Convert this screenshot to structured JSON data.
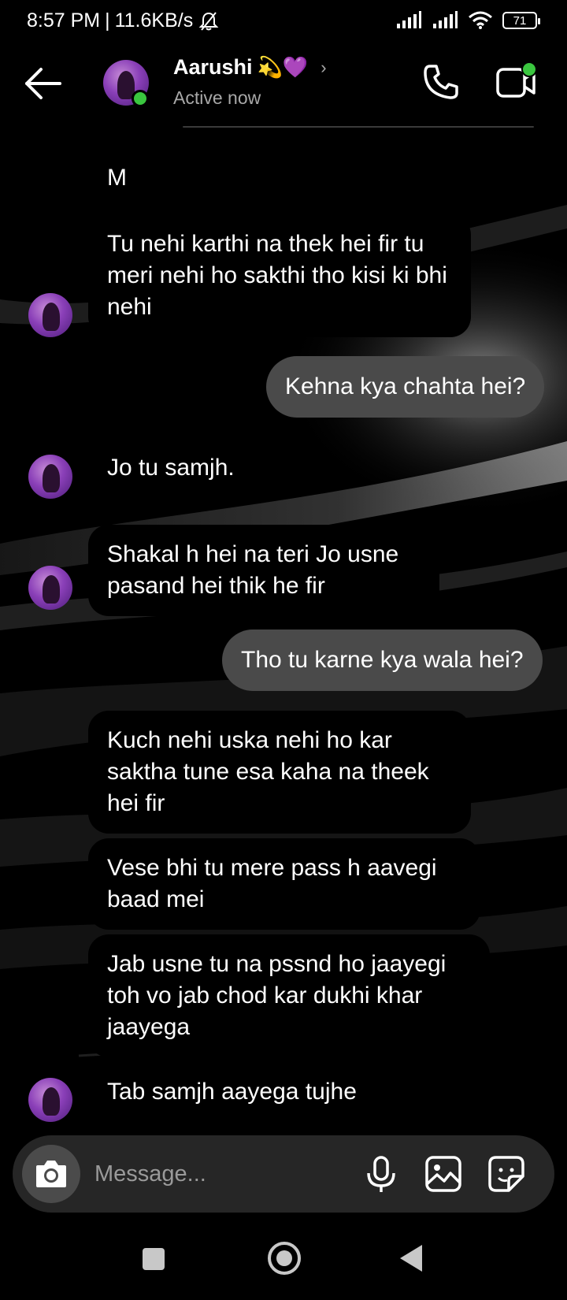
{
  "status_bar": {
    "time": "8:57 PM",
    "separator": "|",
    "speed": "11.6KB/s",
    "battery": "71",
    "icons": [
      "mute-bell-icon",
      "signal-icon",
      "signal-icon",
      "wifi-icon",
      "battery-icon"
    ]
  },
  "header": {
    "contact_name": "Aarushi",
    "name_emoji": "💫💜",
    "chevron": "›",
    "status": "Active now",
    "online_color": "#3ac63f"
  },
  "messages": [
    {
      "side": "received",
      "text": "M"
    },
    {
      "side": "received",
      "text": "Tu nehi karthi na thek hei fir tu meri nehi ho sakthi tho kisi ki bhi nehi"
    },
    {
      "side": "sent",
      "text": "Kehna kya chahta hei?"
    },
    {
      "side": "received",
      "text": "Jo tu samjh."
    },
    {
      "side": "received",
      "text": "Shakal h hei na teri Jo usne pasand hei thik he fir"
    },
    {
      "side": "sent",
      "text": "Tho tu karne kya wala hei?"
    },
    {
      "side": "received",
      "text": "Kuch nehi uska nehi ho kar saktha tune esa kaha na theek hei fir"
    },
    {
      "side": "received",
      "text": "Vese bhi tu mere pass h aavegi baad mei"
    },
    {
      "side": "received",
      "text": "Jab usne tu na pssnd ho jaayegi toh vo jab chod kar dukhi khar jaayega"
    },
    {
      "side": "received",
      "text": "Tab samjh aayega tujhe"
    }
  ],
  "composer": {
    "placeholder": "Message..."
  },
  "colors": {
    "sent_bubble": "#4a4a4a",
    "received_bubble": "#000000",
    "composer_bg": "#262626"
  }
}
